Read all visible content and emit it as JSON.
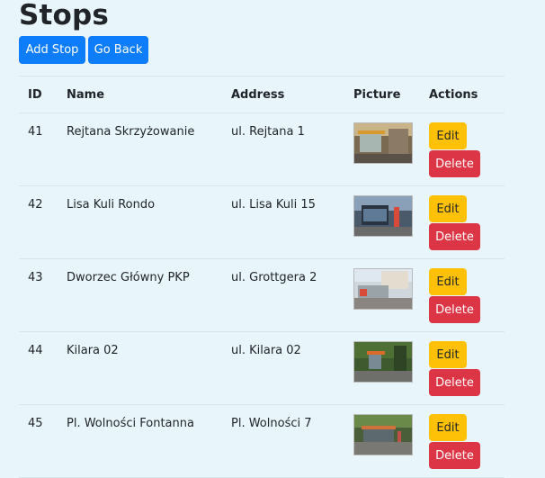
{
  "page": {
    "title": "Stops"
  },
  "toolbar": {
    "add_label": "Add Stop",
    "back_label": "Go Back"
  },
  "table": {
    "headers": {
      "id": "ID",
      "name": "Name",
      "address": "Address",
      "picture": "Picture",
      "actions": "Actions"
    },
    "rows": [
      {
        "id": "41",
        "name": "Rejtana Skrzyżowanie",
        "address": "ul. Rejtana 1",
        "edit": "Edit",
        "delete": "Delete"
      },
      {
        "id": "42",
        "name": "Lisa Kuli Rondo",
        "address": "ul. Lisa Kuli 15",
        "edit": "Edit",
        "delete": "Delete"
      },
      {
        "id": "43",
        "name": "Dworzec Główny PKP",
        "address": "ul. Grottgera 2",
        "edit": "Edit",
        "delete": "Delete"
      },
      {
        "id": "44",
        "name": "Kilara 02",
        "address": "ul. Kilara 02",
        "edit": "Edit",
        "delete": "Delete"
      },
      {
        "id": "45",
        "name": "Pl. Wolności Fontanna",
        "address": "Pl. Wolności 7",
        "edit": "Edit",
        "delete": "Delete"
      }
    ]
  },
  "colors": {
    "primary": "#0d7dfb",
    "warning": "#ffc107",
    "danger": "#dc3545",
    "background": "#e8f6fb"
  }
}
